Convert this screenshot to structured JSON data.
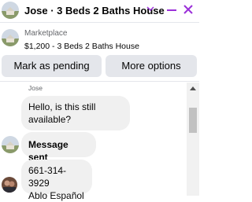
{
  "header": {
    "title": "Jose · 3 Beds 2 Baths House",
    "chevron_icon": "chevron-down-icon",
    "minimize_icon": "minimize-icon",
    "close_icon": "close-icon",
    "accent_color": "#9b30d9"
  },
  "listing": {
    "source": "Marketplace",
    "price_title": "$1,200 - 3 Beds 2 Baths House"
  },
  "actions": {
    "mark_pending": "Mark as pending",
    "more_options": "More options"
  },
  "conversation": {
    "sender": "Jose",
    "messages": [
      {
        "lines": [
          "Hello, is this still",
          "available?"
        ]
      },
      {
        "lines": [
          "Message sent"
        ]
      },
      {
        "lines": [
          "661-314-3929",
          "Ablo Español"
        ]
      }
    ]
  }
}
